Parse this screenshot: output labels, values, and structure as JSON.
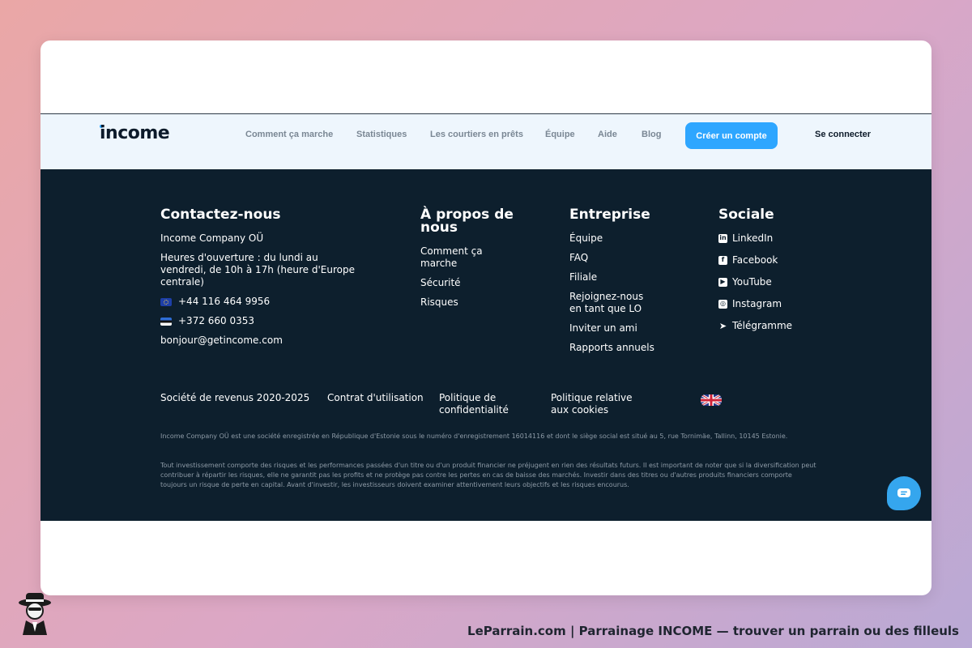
{
  "nav": {
    "logo": "income",
    "links": [
      "Comment ça marche",
      "Statistiques",
      "Les courtiers en prêts",
      "Équipe",
      "Aide",
      "Blog"
    ],
    "create_account": "Créer un compte",
    "login": "Se connecter"
  },
  "footer": {
    "contact": {
      "heading": "Contactez-nous",
      "company": "Income Company OÜ",
      "hours": "Heures d'ouverture : du lundi au vendredi, de 10h à 17h (heure d'Europe centrale)",
      "phone_eu": "+44 116 464 9956",
      "phone_ee": "+372 660 0353",
      "email": "bonjour@getincome.com"
    },
    "about": {
      "heading": "À propos de nous",
      "items": [
        "Comment ça marche",
        "Sécurité",
        "Risques"
      ]
    },
    "company": {
      "heading": "Entreprise",
      "items": [
        "Équipe",
        "FAQ",
        "Filiale",
        "Rejoignez-nous en tant que LO",
        "Inviter un ami",
        "Rapports annuels"
      ]
    },
    "social": {
      "heading": "Sociale",
      "items": [
        {
          "label": "LinkedIn",
          "icon": "linkedin-icon"
        },
        {
          "label": "Facebook",
          "icon": "facebook-icon"
        },
        {
          "label": "YouTube",
          "icon": "youtube-icon"
        },
        {
          "label": "Instagram",
          "icon": "instagram-icon"
        },
        {
          "label": "Télégramme",
          "icon": "telegram-icon"
        }
      ]
    },
    "legal": {
      "copyright": "Société de revenus 2020-2025",
      "terms": "Contrat d'utilisation",
      "privacy": "Politique de confidentialité",
      "cookies": "Politique relative aux cookies",
      "language_flag": "uk-flag-icon"
    },
    "disclaimer_1": "Income Company OÜ est une société enregistrée en République d'Estonie sous le numéro d'enregistrement 16014116 et dont le siège social est situé au 5, rue Tornimäe, Tallinn, 10145 Estonie.",
    "disclaimer_2": "Tout investissement comporte des risques et les performances passées d'un titre ou d'un produit financier ne préjugent en rien des résultats futurs. Il est important de noter que si la diversification peut contribuer à répartir les risques, elle ne garantit pas les profits et ne protège pas contre les pertes en cas de baisse des marchés. Investir dans des titres ou d'autres produits financiers comporte toujours un risque de perte en capital. Avant d'investir, les investisseurs doivent examiner attentivement leurs objectifs et les risques encourus."
  },
  "caption": "LeParrain.com | Parrainage INCOME — trouver un parrain ou des filleuls",
  "colors": {
    "accent": "#2ea6ff",
    "footer_bg": "#0d1f2d",
    "nav_bg": "#eef6fd"
  }
}
